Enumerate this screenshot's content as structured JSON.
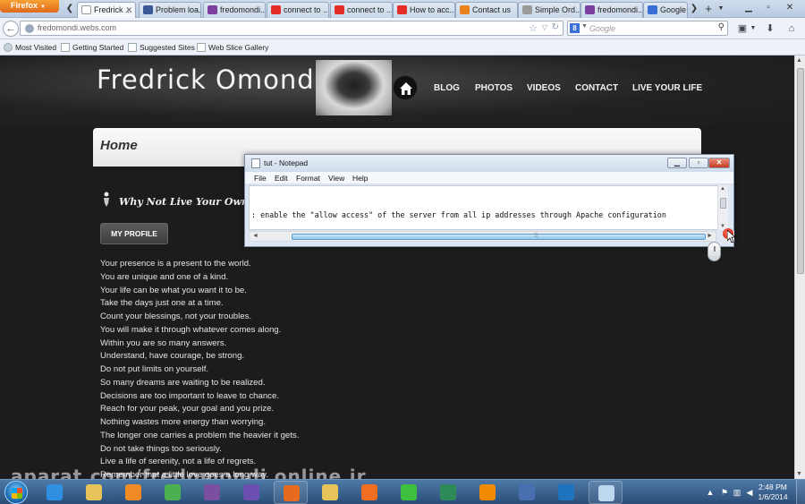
{
  "browser": {
    "menu_button": "Firefox",
    "tabs": [
      {
        "label": "Fredrick ...",
        "icon_color": "#888888",
        "active": true
      },
      {
        "label": "Problem loa...",
        "icon_color": "#3b5998"
      },
      {
        "label": "fredomondi...",
        "icon_color": "#7b3fa0"
      },
      {
        "label": "connect to ...",
        "icon_color": "#e52d27"
      },
      {
        "label": "connect to ...",
        "icon_color": "#e52d27"
      },
      {
        "label": "How to acc...",
        "icon_color": "#e52d27"
      },
      {
        "label": "Contact us",
        "icon_color": "#e8821e"
      },
      {
        "label": "Simple Ord...",
        "icon_color": "#9a9a9a"
      },
      {
        "label": "fredomondi...",
        "icon_color": "#7b3fa0"
      },
      {
        "label": "Google",
        "icon_color": "#3a6fd8"
      }
    ],
    "url": "fredomondi.webs.com",
    "search_placeholder": "Google",
    "search_engine_letter": "8",
    "bookmarks": [
      "Most Visited",
      "Getting Started",
      "Suggested Sites",
      "Web Slice Gallery"
    ]
  },
  "site": {
    "title": "Fredrick Omondi",
    "nav": [
      "BLOG",
      "PHOTOS",
      "VIDEOS",
      "CONTACT",
      "LIVE YOUR LIFE"
    ],
    "home_heading": "Home",
    "slogan": "Why Not Live Your Own L",
    "profile_button": "MY PROFILE",
    "poem_lines": [
      "Your presence is a present to the world.",
      "You are unique and one of a kind.",
      "Your life can be what you want it to be.",
      "Take the days just one at a time.",
      "Count your blessings, not your troubles.",
      "You will make it through whatever comes along.",
      "Within you are so many answers.",
      "Understand, have courage, be strong.",
      "Do not put limits on yourself.",
      "So many dreams are waiting to be realized.",
      "Decisions are too important to leave to chance.",
      "Reach for your peak, your goal and you prize.",
      "Nothing wastes more energy than worrying.",
      "The longer one carries a problem the heavier it gets.",
      "Do not take things too seriously.",
      "Live a life of serenity, not a life of regrets.",
      "Remember that a little love goes a long way."
    ]
  },
  "notepad": {
    "title": "tut - Notepad",
    "menu": [
      "File",
      "Edit",
      "Format",
      "View",
      "Help"
    ],
    "text": ": enable the \"allow access\" of the server from all ip addresses through Apache configuration"
  },
  "taskbar": {
    "apps": [
      {
        "name": "internet-explorer",
        "color": "#2f8fe0"
      },
      {
        "name": "file-explorer",
        "color": "#e7c45a"
      },
      {
        "name": "media-player",
        "color": "#f08a24"
      },
      {
        "name": "chrome",
        "color": "#4caf50"
      },
      {
        "name": "winrar",
        "color": "#7a4fa0"
      },
      {
        "name": "visual-studio",
        "color": "#6b4fb0"
      },
      {
        "name": "firefox",
        "color": "#e66b1f",
        "running": true
      },
      {
        "name": "folder",
        "color": "#e7c45a"
      },
      {
        "name": "xampp",
        "color": "#f06d22"
      },
      {
        "name": "green-app",
        "color": "#3fbf3f"
      },
      {
        "name": "network-globe",
        "color": "#2e8b57"
      },
      {
        "name": "vlc",
        "color": "#f08a00"
      },
      {
        "name": "video-editor",
        "color": "#4a6fb0"
      },
      {
        "name": "teamviewer",
        "color": "#1e73be"
      },
      {
        "name": "notepad",
        "color": "#bcd7ee",
        "running": true
      }
    ],
    "time": "2:48 PM",
    "date": "1/6/2014"
  },
  "watermark": "aparat.com/fredomondi online.ir"
}
